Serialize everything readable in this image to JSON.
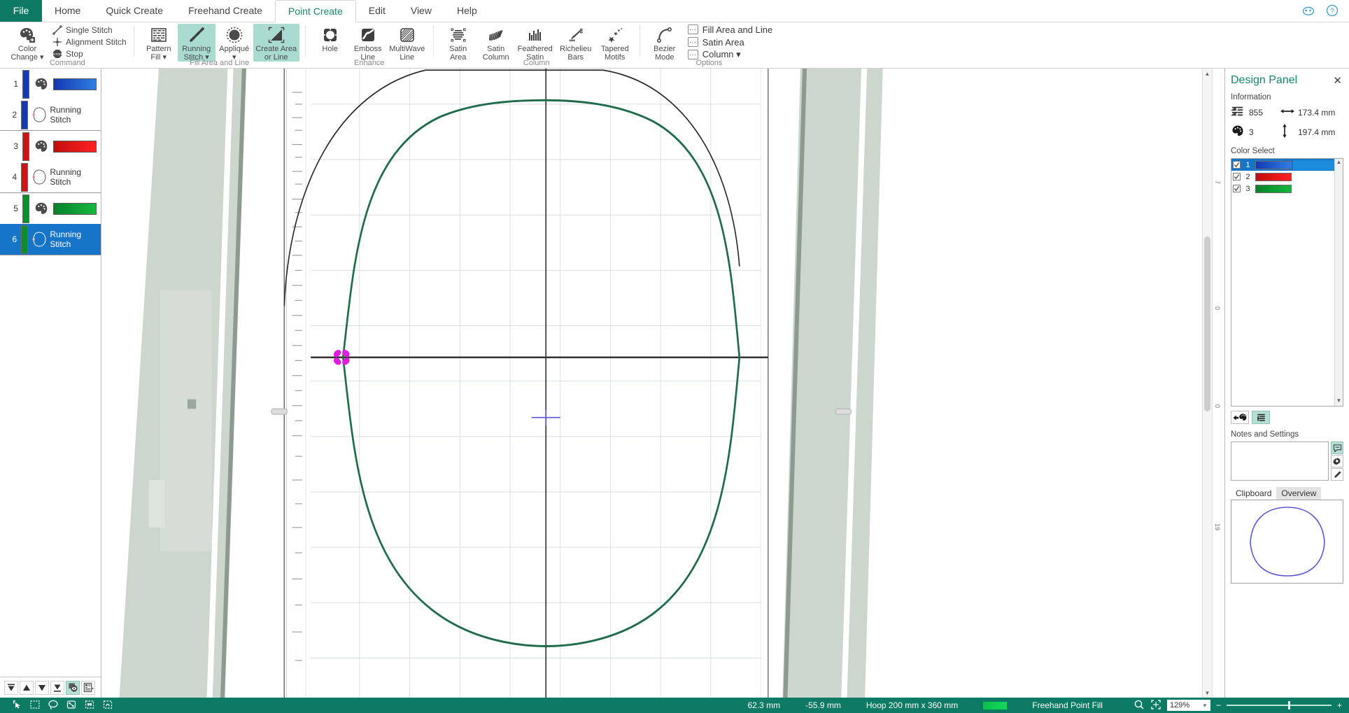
{
  "window": {
    "title": "Point Create"
  },
  "tabs": [
    {
      "label": "File",
      "active": false,
      "file": true
    },
    {
      "label": "Home",
      "active": false
    },
    {
      "label": "Quick Create",
      "active": false
    },
    {
      "label": "Freehand Create",
      "active": false
    },
    {
      "label": "Point Create",
      "active": true
    },
    {
      "label": "Edit",
      "active": false
    },
    {
      "label": "View",
      "active": false
    },
    {
      "label": "Help",
      "active": false
    }
  ],
  "titlebar_icons": [
    "account-icon",
    "help-icon"
  ],
  "ribbon": {
    "groups": [
      {
        "name": "Command",
        "label": "Command",
        "big": [
          {
            "label": "Color\nChange",
            "icon": "palette-plus-icon",
            "dropdown": true,
            "selected": false
          }
        ],
        "small": [
          {
            "label": "Single Stitch",
            "icon": "single-stitch-icon"
          },
          {
            "label": "Alignment Stitch",
            "icon": "alignment-stitch-icon"
          },
          {
            "label": "Stop",
            "icon": "stop-icon"
          }
        ]
      },
      {
        "name": "Fill Area and Line",
        "label": "Fill Area and Line",
        "big": [
          {
            "label": "Pattern\nFill",
            "icon": "pattern-fill-icon",
            "dropdown": true,
            "selected": false
          },
          {
            "label": "Running\nStitch",
            "icon": "running-stitch-icon",
            "dropdown": true,
            "selected": true
          },
          {
            "label": "Appliqué",
            "icon": "applique-icon",
            "dropdown": true,
            "selected": false
          },
          {
            "label": "Create Area\nor Line",
            "icon": "create-area-or-line-icon",
            "dropdown": false,
            "selected": true
          }
        ]
      },
      {
        "name": "Enhance",
        "label": "Enhance",
        "big": [
          {
            "label": "Hole",
            "icon": "hole-icon",
            "selected": false
          },
          {
            "label": "Emboss\nLine",
            "icon": "emboss-line-icon",
            "selected": false
          },
          {
            "label": "MultiWave\nLine",
            "icon": "multiwave-line-icon",
            "selected": false
          }
        ]
      },
      {
        "name": "Column",
        "label": "Column",
        "big": [
          {
            "label": "Satin\nArea",
            "icon": "satin-area-icon",
            "selected": false
          },
          {
            "label": "Satin\nColumn",
            "icon": "satin-column-icon",
            "selected": false
          },
          {
            "label": "Feathered\nSatin",
            "icon": "feathered-satin-icon",
            "selected": false
          },
          {
            "label": "Richelieu\nBars",
            "icon": "richelieu-bars-icon",
            "selected": false
          },
          {
            "label": "Tapered\nMotifs",
            "icon": "tapered-motifs-icon",
            "selected": false
          }
        ]
      },
      {
        "name": "Options",
        "label": "Options",
        "big": [
          {
            "label": "Bezier\nMode",
            "icon": "bezier-mode-icon",
            "selected": false
          }
        ],
        "options": [
          {
            "label": "Fill Area and Line",
            "icon": "ellipsis-box-icon",
            "dropdown": false
          },
          {
            "label": "Satin Area",
            "icon": "ellipsis-box-icon",
            "dropdown": false
          },
          {
            "label": "Column",
            "icon": "ellipsis-box-icon",
            "dropdown": true
          }
        ]
      }
    ]
  },
  "stitch_list": {
    "groups": [
      {
        "color": "#1538b5",
        "color_light": "#1a5fd0",
        "rows": [
          {
            "num": "1",
            "type": "color-change",
            "label": "",
            "swatch": "#1e4fd8"
          },
          {
            "num": "2",
            "type": "running-stitch",
            "label": "Running Stitch",
            "swatch": null
          }
        ]
      },
      {
        "color": "#d01414",
        "color_light": "#e02020",
        "rows": [
          {
            "num": "3",
            "type": "color-change",
            "label": "",
            "swatch": "#e01414"
          },
          {
            "num": "4",
            "type": "running-stitch",
            "label": "Running Stitch",
            "swatch": null
          }
        ]
      },
      {
        "color": "#0a8f2c",
        "color_light": "#10a836",
        "rows": [
          {
            "num": "5",
            "type": "color-change",
            "label": "",
            "swatch": "#0ea331"
          },
          {
            "num": "6",
            "type": "running-stitch",
            "label": "Running Stitch",
            "swatch": null,
            "selected": true
          }
        ]
      }
    ],
    "bottom_buttons": [
      {
        "name": "move-to-start-button",
        "icon": "move-to-start-icon",
        "active": false
      },
      {
        "name": "move-up-button",
        "icon": "move-up-icon",
        "active": false
      },
      {
        "name": "move-down-button",
        "icon": "move-down-icon",
        "active": false
      },
      {
        "name": "move-to-end-button",
        "icon": "move-to-end-icon",
        "active": false
      },
      {
        "name": "show-stitch-preview-button",
        "icon": "preview-eye-icon",
        "active": true
      },
      {
        "name": "list-options-button",
        "icon": "list-options-icon",
        "active": false
      }
    ]
  },
  "design_panel": {
    "title": "Design Panel",
    "close": "✕",
    "information_label": "Information",
    "stitch_count": "855",
    "color_count": "3",
    "width": "173.4 mm",
    "height": "197.4 mm",
    "stitch_icon": "stitch-count-icon",
    "palette_icon": "palette-icon",
    "width_icon": "arrows-horizontal-icon",
    "height_icon": "arrows-vertical-icon",
    "color_select_label": "Color Select",
    "colors": [
      {
        "num": "1",
        "color": "#1e4fd8",
        "checked": true,
        "selected": true
      },
      {
        "num": "2",
        "color": "#e01414",
        "checked": true,
        "selected": false
      },
      {
        "num": "3",
        "color": "#0ea331",
        "checked": true,
        "selected": false
      }
    ],
    "tool_buttons": [
      {
        "name": "color-sort-button",
        "icon": "arrow-palette-icon",
        "active": false
      },
      {
        "name": "list-view-button",
        "icon": "list-view-icon",
        "active": true
      }
    ],
    "notes_label": "Notes and Settings",
    "notes_value": "",
    "notes_buttons": [
      {
        "name": "notes-button",
        "icon": "notes-bubble-icon",
        "active": true
      },
      {
        "name": "settings-button",
        "icon": "gear-icon",
        "active": false
      },
      {
        "name": "edit-button",
        "icon": "pencil-icon",
        "active": false
      }
    ],
    "tabs": [
      {
        "label": "Clipboard",
        "active": true
      },
      {
        "label": "Overview",
        "active": false
      }
    ],
    "preview_shape_color": "#5b57d8"
  },
  "statusbar": {
    "tools": [
      {
        "name": "select-tool",
        "icon": "select-arrow-icon"
      },
      {
        "name": "rectangle-select-tool",
        "icon": "rect-select-icon"
      },
      {
        "name": "lasso-select-tool",
        "icon": "lasso-icon"
      },
      {
        "name": "resize-tool",
        "icon": "resize-icon"
      },
      {
        "name": "move-tool",
        "icon": "move-tool-icon"
      },
      {
        "name": "transform-tool",
        "icon": "transform-icon"
      }
    ],
    "x_coord": "62.3 mm",
    "y_coord": "-55.9 mm",
    "hoop": "Hoop 200 mm x 360 mm",
    "current_color": "#12cf58",
    "mode": "Freehand Point Fill",
    "zoom_icons": [
      "zoom-magnifier-icon",
      "fit-to-window-icon"
    ],
    "zoom_value": "129%",
    "zoom_minus": "−",
    "zoom_plus": "+"
  },
  "canvas": {
    "vertical_ruler_marks": [
      "7",
      "0",
      "0",
      "19"
    ]
  },
  "colors": {
    "accent": "#0d7a63",
    "tab_active_text": "#13866d",
    "selection": "#1675c9",
    "ribbon_selected": "#a9dbd0",
    "design_outline": "#1f6b4a",
    "hoop_fill": "#ccd6cd"
  }
}
